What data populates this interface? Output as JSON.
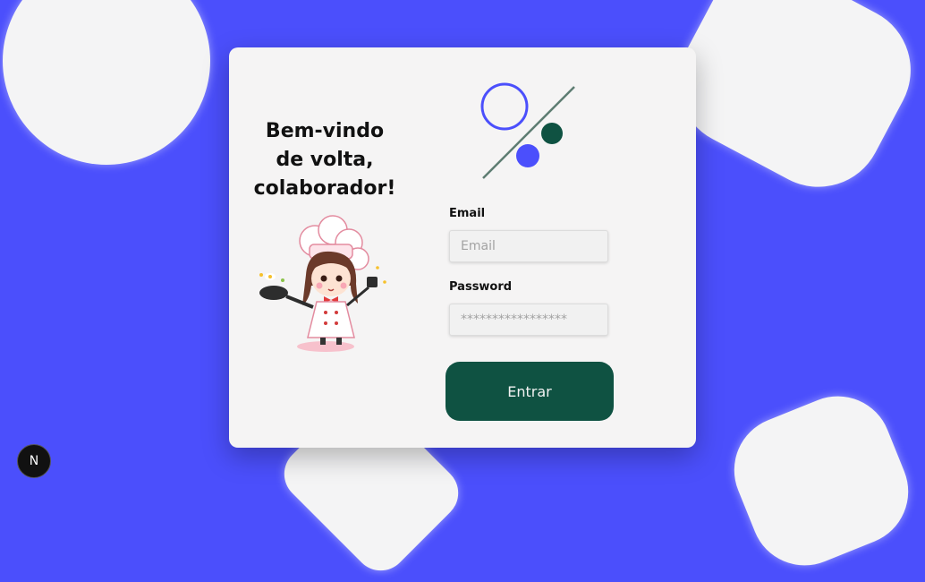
{
  "welcome": {
    "line1": "Bem-vindo",
    "line2": "de volta,",
    "line3": "colaborador!"
  },
  "form": {
    "email_label": "Email",
    "email_placeholder": "Email",
    "password_label": "Password",
    "password_placeholder": "*****************",
    "submit_label": "Entrar"
  },
  "badge": {
    "letter": "N"
  },
  "icons": {
    "logo": "percent-logo-icon",
    "illustration": "chef-girl-illustration",
    "badge": "dev-badge-icon"
  },
  "colors": {
    "background": "#4b4ffc",
    "card": "#f5f4f4",
    "primary_button": "#0f5242",
    "logo_accent_blue": "#4b4ffc",
    "logo_accent_green": "#0f5242"
  }
}
